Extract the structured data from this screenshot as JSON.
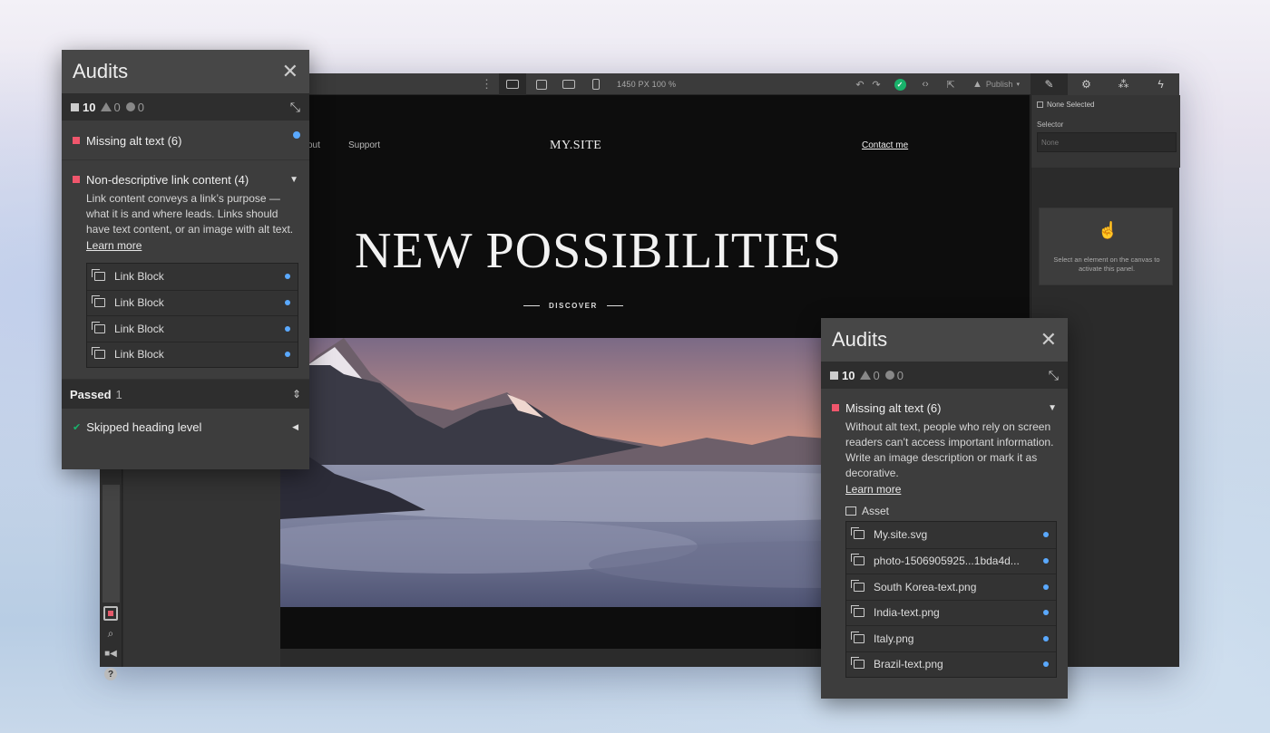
{
  "editor": {
    "menu_dots": "⋮",
    "canvas_size": "1450 PX  100 %",
    "publish_label": "Publish",
    "right_tabs": [
      "brush-icon",
      "gear-icon",
      "drops-icon",
      "bolt-icon"
    ],
    "selection_status": "None Selected",
    "selector_label": "Selector",
    "selector_placeholder": "None",
    "empty_panel_text": "Select an element on the canvas to activate this panel."
  },
  "site": {
    "nav_about_fragment": "out",
    "nav_support": "Support",
    "logo": "MY.SITE",
    "contact": "Contact me",
    "hero_title": "NEW POSSIBILITIES",
    "discover": "DISCOVER"
  },
  "audit_left": {
    "title": "Audits",
    "close": "✕",
    "summary": {
      "errors": "10",
      "warnings": "0",
      "info": "0"
    },
    "issue1": {
      "title": "Missing alt text (6)"
    },
    "issue2": {
      "title": "Non-descriptive link content (4)",
      "description": "Link content conveys a link’s purpose — what it is and where leads. Links should have text content, or an image with alt text.",
      "learn_more": "Learn more",
      "items": [
        "Link Block",
        "Link Block",
        "Link Block",
        "Link Block"
      ]
    },
    "passed": {
      "label": "Passed",
      "count": "1"
    },
    "passed_item": "Skipped heading level"
  },
  "audit_right": {
    "title": "Audits",
    "close": "✕",
    "summary": {
      "errors": "10",
      "warnings": "0",
      "info": "0"
    },
    "issue": {
      "title": "Missing alt text (6)",
      "description": "Without alt text, people who rely on screen readers can’t access important information. Write an image description or mark it as decorative.",
      "learn_more": "Learn more",
      "asset_label": "Asset",
      "items": [
        "My.site.svg",
        "photo-1506905925...1bda4d...",
        "South Korea-text.png",
        "India-text.png",
        "Italy.png",
        "Brazil-text.png"
      ]
    }
  },
  "colors": {
    "error": "#f0566c",
    "success": "#19b26b",
    "link_dot": "#5aa9ff"
  }
}
